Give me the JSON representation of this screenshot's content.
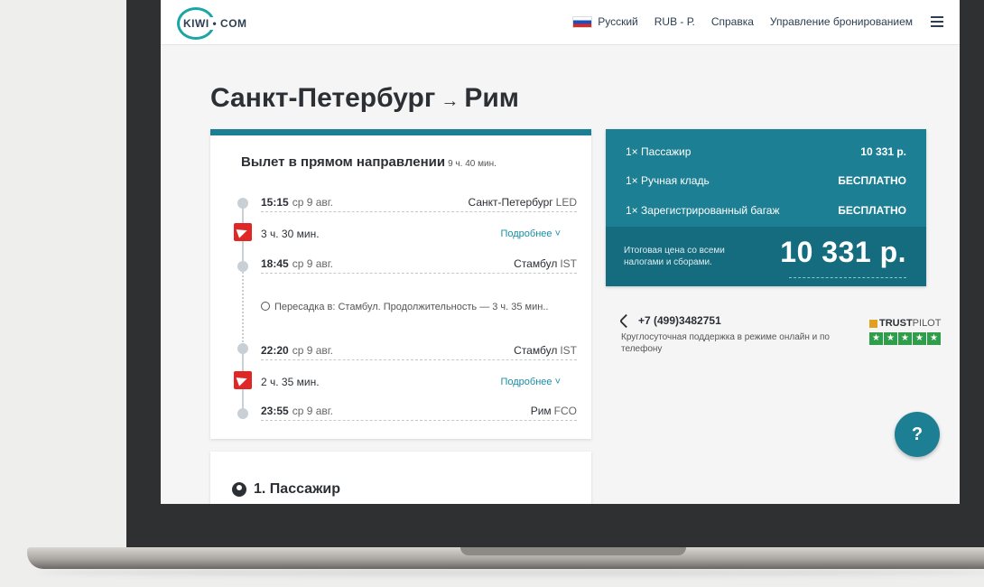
{
  "header": {
    "logo": "KIWI • COM",
    "language": "Русский",
    "currency": "RUB - Р.",
    "help": "Справка",
    "manage": "Управление бронированием"
  },
  "page_title": {
    "from": "Санкт-Петербург",
    "arrow": "→",
    "to": "Рим"
  },
  "itinerary": {
    "title": "Вылет в прямом направлении",
    "duration": "9 ч. 40 мин.",
    "segments": [
      {
        "time": "15:15",
        "date": "ср 9 авг.",
        "city": "Санкт-Петербург",
        "code": "LED"
      },
      {
        "flight_duration": "3 ч. 30 мин.",
        "more": "Подробнее ˅"
      },
      {
        "time": "18:45",
        "date": "ср 9 авг.",
        "city": "Стамбул",
        "code": "IST"
      },
      {
        "layover": "Пересадка в: Стамбул. Продолжительность — 3 ч. 35 мин.."
      },
      {
        "time": "22:20",
        "date": "ср 9 авг.",
        "city": "Стамбул",
        "code": "IST"
      },
      {
        "flight_duration": "2 ч. 35 мин.",
        "more": "Подробнее ˅"
      },
      {
        "time": "23:55",
        "date": "ср 9 авг.",
        "city": "Рим",
        "code": "FCO"
      }
    ]
  },
  "passenger_section": {
    "title": "1. Пассажир"
  },
  "price": {
    "rows": [
      {
        "label": "1× Пассажир",
        "value": "10 331 р."
      },
      {
        "label": "1× Ручная кладь",
        "value": "БЕСПЛАТНО"
      },
      {
        "label": "1× Зарегистрированный багаж",
        "value": "БЕСПЛАТНО"
      }
    ],
    "total_label": "Итоговая цена со всеми налогами и сборами.",
    "total_value": "10 331 р."
  },
  "support": {
    "phone": "+7 (499)3482751",
    "text": "Круглосуточная поддержка в режиме онлайн и по телефону"
  },
  "trustpilot": {
    "brand_bold": "TRUST",
    "brand_light": "PILOT",
    "star": "★"
  },
  "help_button": "?",
  "colors": {
    "accent": "#1c7f93",
    "airline": "#e02727",
    "trust_green": "#2e9e4a"
  }
}
